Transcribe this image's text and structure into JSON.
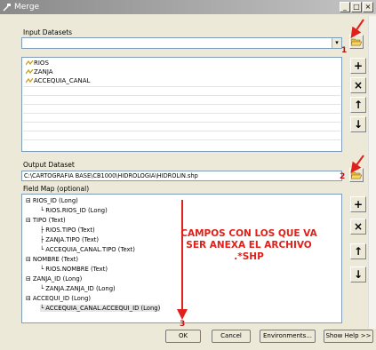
{
  "window": {
    "title": "Merge"
  },
  "input_datasets": {
    "label": "Input Datasets",
    "combo_value": "",
    "items": [
      "RIOS",
      "ZANJA",
      "ACCEQUIA_CANAL"
    ]
  },
  "output_dataset": {
    "label": "Output Dataset",
    "value": "C:\\CARTOGRAFIA BASE\\CB1000\\HIDROLOGIA\\HIDROLIN.shp"
  },
  "field_map": {
    "label": "Field Map (optional)",
    "items": [
      "RIOS_ID (Long)",
      "RIOS.RIOS_ID (Long)",
      "TIPO (Text)",
      "RIOS.TIPO (Text)",
      "ZANJA.TIPO (Text)",
      "ACCEQUIA_CANAL.TIPO (Text)",
      "NOMBRE (Text)",
      "RIOS.NOMBRE (Text)",
      "ZANJA_ID (Long)",
      "ZANJA.ZANJA_ID (Long)",
      "ACCEQUI_ID (Long)",
      "ACCEQUIA_CANAL.ACCEQUI_ID (Long)"
    ]
  },
  "annotation": {
    "text": "CAMPOS CON LOS QUE VA SER ANEXA EL ARCHIVO .*SHP",
    "num1": "1",
    "num2": "2",
    "num3": "3"
  },
  "buttons": {
    "ok": "OK",
    "cancel": "Cancel",
    "environments": "Environments...",
    "show_help": "Show Help >>"
  },
  "side_buttons": {
    "add": "+",
    "remove": "×",
    "up": "↑",
    "down": "↓"
  },
  "colors": {
    "annotation": "#e0201a",
    "folder": "#e6b83a"
  }
}
